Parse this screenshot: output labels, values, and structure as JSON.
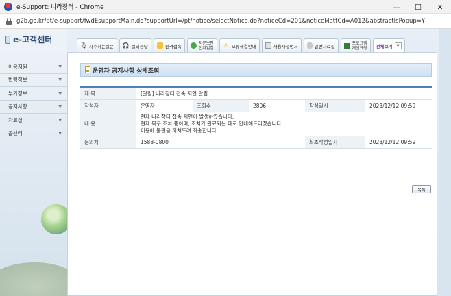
{
  "window": {
    "title": "e-Support: 나라장터 - Chrome",
    "controls": {
      "minimize": "—",
      "maximize": "☐",
      "close": "✕"
    }
  },
  "address_bar": {
    "url": "g2b.go.kr/pt/e-support/fwdEsupportMain.do?supportUrl=/pt/notice/selectNotice.do?noticeCd=201&noticeMattCd=A012&abstractIsPopup=Y"
  },
  "logo": {
    "text": "e-고객센터"
  },
  "sidebar": {
    "items": [
      {
        "label": "이용지원"
      },
      {
        "label": "법령정보"
      },
      {
        "label": "부가정보"
      },
      {
        "label": "공지사항"
      },
      {
        "label": "자료실"
      },
      {
        "label": "콜센터"
      }
    ]
  },
  "tabs": [
    {
      "label": "자주하는질문",
      "icon": "mic-icon"
    },
    {
      "label": "질의응답",
      "icon": "headset-icon"
    },
    {
      "label": "원격접속",
      "icon": "remote-icon"
    },
    {
      "label_line1": "지문보안",
      "label_line2": "전자입찰",
      "icon": "fingerprint-icon"
    },
    {
      "label": "오류해결안내",
      "icon": "warning-icon"
    },
    {
      "label": "사용자설명서",
      "icon": "manual-icon"
    },
    {
      "label": "일반자료실",
      "icon": "database-icon"
    },
    {
      "label_line1": "프로그램",
      "label_line2": "개선요청",
      "icon": "program-icon"
    },
    {
      "label": "전체보기",
      "icon": "dropdown-icon"
    }
  ],
  "panel": {
    "title": "운영자 공지사항 상세조회",
    "labels": {
      "subject": "제 목",
      "author": "작성자",
      "views": "조회수",
      "date": "작성일시",
      "content": "내 용",
      "contact": "문의처",
      "final_date": "최초작성일시"
    },
    "values": {
      "subject": "[알림] 나라장터 접속 지연 알림",
      "author": "운영자",
      "views": "2806",
      "date": "2023/12/12 09:59",
      "content_line1": "현재 나라장터 접속 지연이 발생하였습니다.",
      "content_line2": "현재 복구 조치 중이며, 조치가 완료되는 대로 안내해드리겠습니다.",
      "content_line3": "이용에 불편을 끼쳐드려 죄송합니다.",
      "contact": "1588-0800",
      "final_date": "2023/12/12 09:59"
    },
    "list_button": "목록"
  }
}
